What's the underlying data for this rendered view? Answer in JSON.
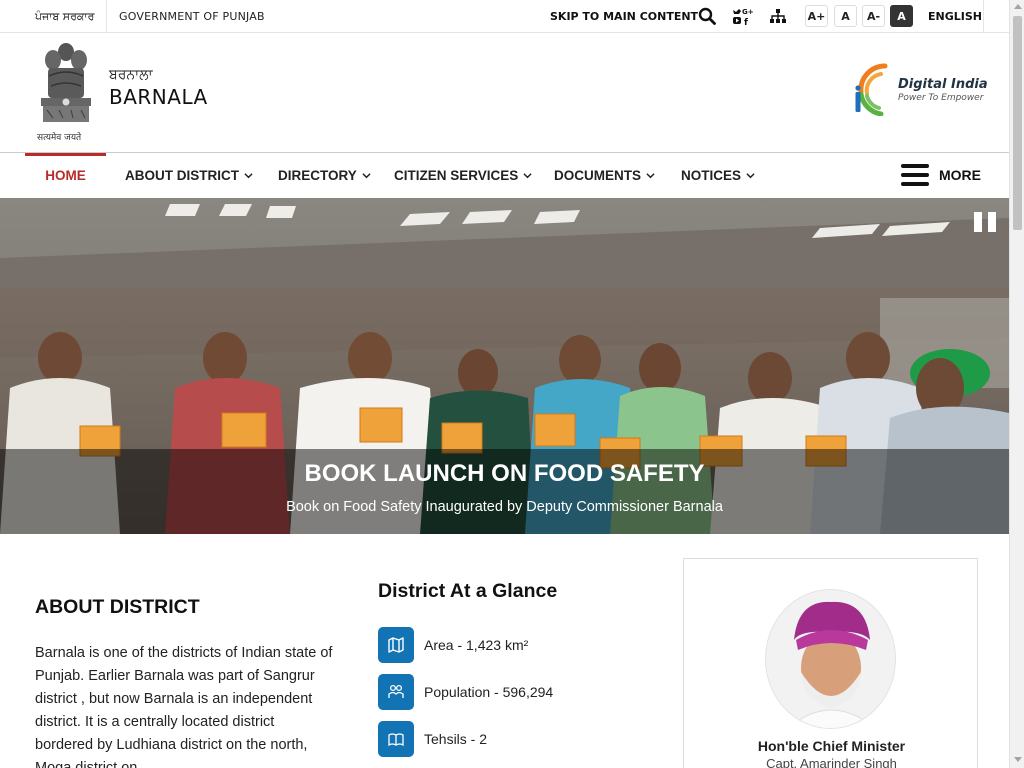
{
  "topbar": {
    "gov_punjabi": "ਪੰਜਾਬ ਸਰਕਾਰ",
    "gov_english": "GOVERNMENT OF PUNJAB",
    "skip_link": "SKIP TO MAIN CONTENT",
    "icons": [
      "search-icon",
      "social-media-icon",
      "sitemap-icon"
    ],
    "font_sizes": [
      "A+",
      "A",
      "A-",
      "A"
    ],
    "language": "ENGLISH"
  },
  "header": {
    "emblem_caption": "सत्यमेव जयते",
    "district_punjabi": "ਬਰਨਾਲਾ",
    "district_english": "BARNALA",
    "digital_india_title": "Digital India",
    "digital_india_tagline": "Power To Empower"
  },
  "nav": {
    "items": [
      {
        "label": "HOME",
        "active": true
      },
      {
        "label": "ABOUT DISTRICT",
        "dropdown": true
      },
      {
        "label": "DIRECTORY",
        "dropdown": true
      },
      {
        "label": "CITIZEN SERVICES",
        "dropdown": true
      },
      {
        "label": "DOCUMENTS",
        "dropdown": true
      },
      {
        "label": "NOTICES",
        "dropdown": true
      }
    ],
    "more_label": "MORE"
  },
  "banner": {
    "title": "BOOK LAUNCH ON FOOD SAFETY",
    "subtitle": "Book on Food Safety Inaugurated by Deputy Commissioner Barnala"
  },
  "about": {
    "title": "ABOUT DISTRICT",
    "text": "Barnala is one of the districts of Indian state of Punjab. Earlier Barnala was part of Sangrur district , but now Barnala is an independent district. It is a centrally located district bordered by Ludhiana district on the north, Moga district on"
  },
  "glance": {
    "title": "District At a Glance",
    "items": [
      {
        "icon": "map-icon",
        "label": "Area - 1,423 km²"
      },
      {
        "icon": "population-icon",
        "label": "Population - 596,294"
      },
      {
        "icon": "book-icon",
        "label": "Tehsils - 2"
      }
    ]
  },
  "cm": {
    "title": "Hon'ble Chief Minister",
    "name": "Capt. Amarinder Singh"
  },
  "colors": {
    "accent": "#b72b2b",
    "icon_blue": "#1274b5"
  }
}
